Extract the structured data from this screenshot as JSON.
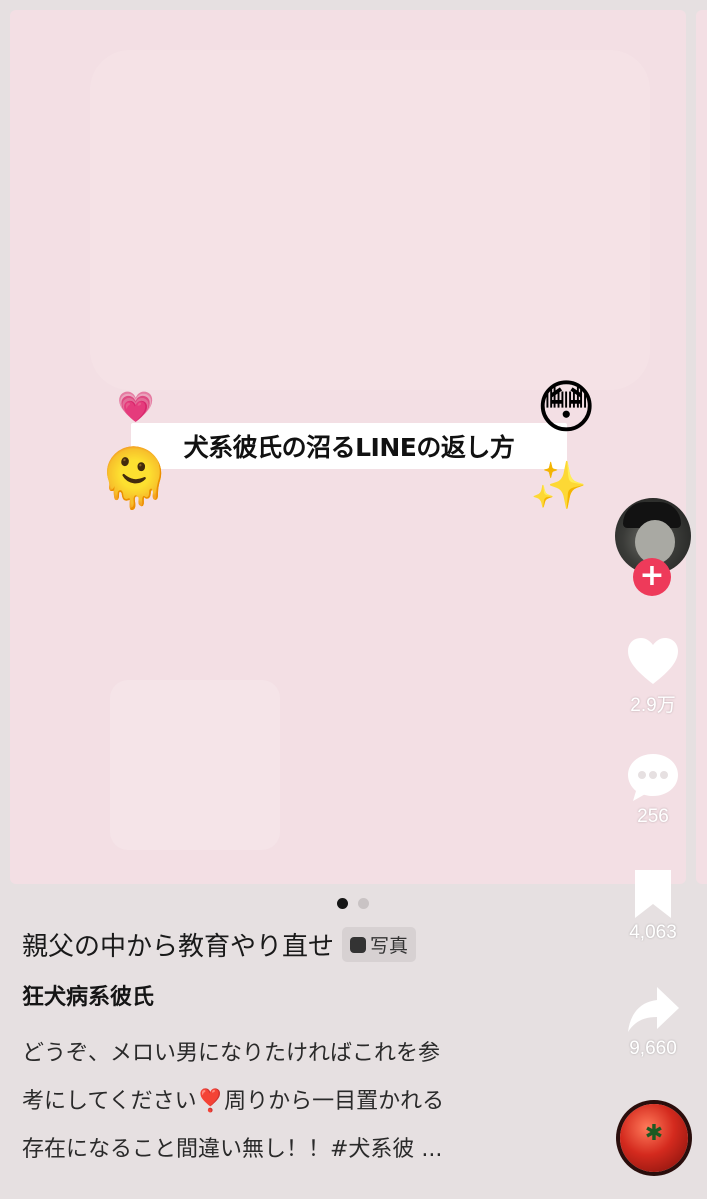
{
  "post": {
    "title_overlay": "犬系彼氏の沼るLINEの返し方",
    "emojis": {
      "heart": "💗",
      "flushed": "😳",
      "melting": "🫠",
      "sparkles": "✨"
    },
    "pagination": {
      "current": 1,
      "total": 2
    },
    "title": "親父の中から教育やり直せ",
    "badge_label": "写真",
    "username": "狂犬病系彼氏",
    "caption_lines": [
      "どうぞ、メロい男になりたければこれを参",
      "考にしてください❣️周りから一目置かれる",
      "存在になること間違い無し！！#犬系彼 ..."
    ]
  },
  "actions": {
    "follow_label": "+",
    "likes": "2.9万",
    "comments": "256",
    "saves": "4,063",
    "shares": "9,660"
  },
  "colors": {
    "photo_background": "#f3dfe4",
    "follow_button": "#ee3a5a",
    "page_background": "#e6e0e1"
  }
}
